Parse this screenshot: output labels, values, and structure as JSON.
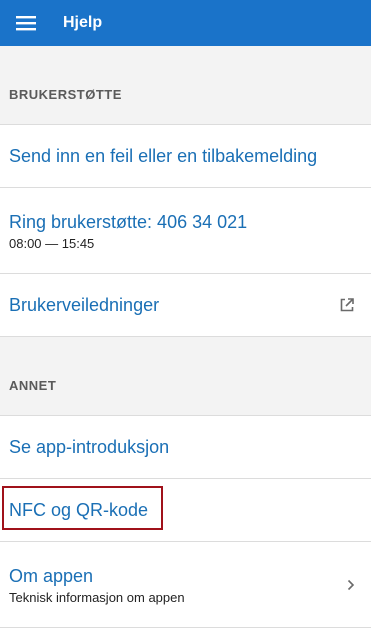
{
  "header": {
    "title": "Hjelp",
    "menu_icon": "hamburger-menu-icon",
    "background_color": "#1a73c9"
  },
  "sections": {
    "support": {
      "title": "BRUKERSTØTTE",
      "items": [
        {
          "label": "Send inn en feil eller en tilbakemelding"
        },
        {
          "label": "Ring brukerstøtte: 406 34 021",
          "subtitle": "08:00 — 15:45"
        },
        {
          "label": "Brukerveiledninger",
          "trailing_icon": "external-link-icon"
        }
      ]
    },
    "other": {
      "title": "ANNET",
      "items": [
        {
          "label": "Se app-introduksjon"
        },
        {
          "label": "NFC og QR-kode",
          "highlighted": true
        },
        {
          "label": "Om appen",
          "subtitle": "Teknisk informasjon om appen",
          "trailing_icon": "chevron-right-icon"
        }
      ]
    }
  },
  "colors": {
    "link": "#1a6fb5",
    "highlight_border": "#a0111a",
    "section_bg": "#f3f3f3"
  }
}
